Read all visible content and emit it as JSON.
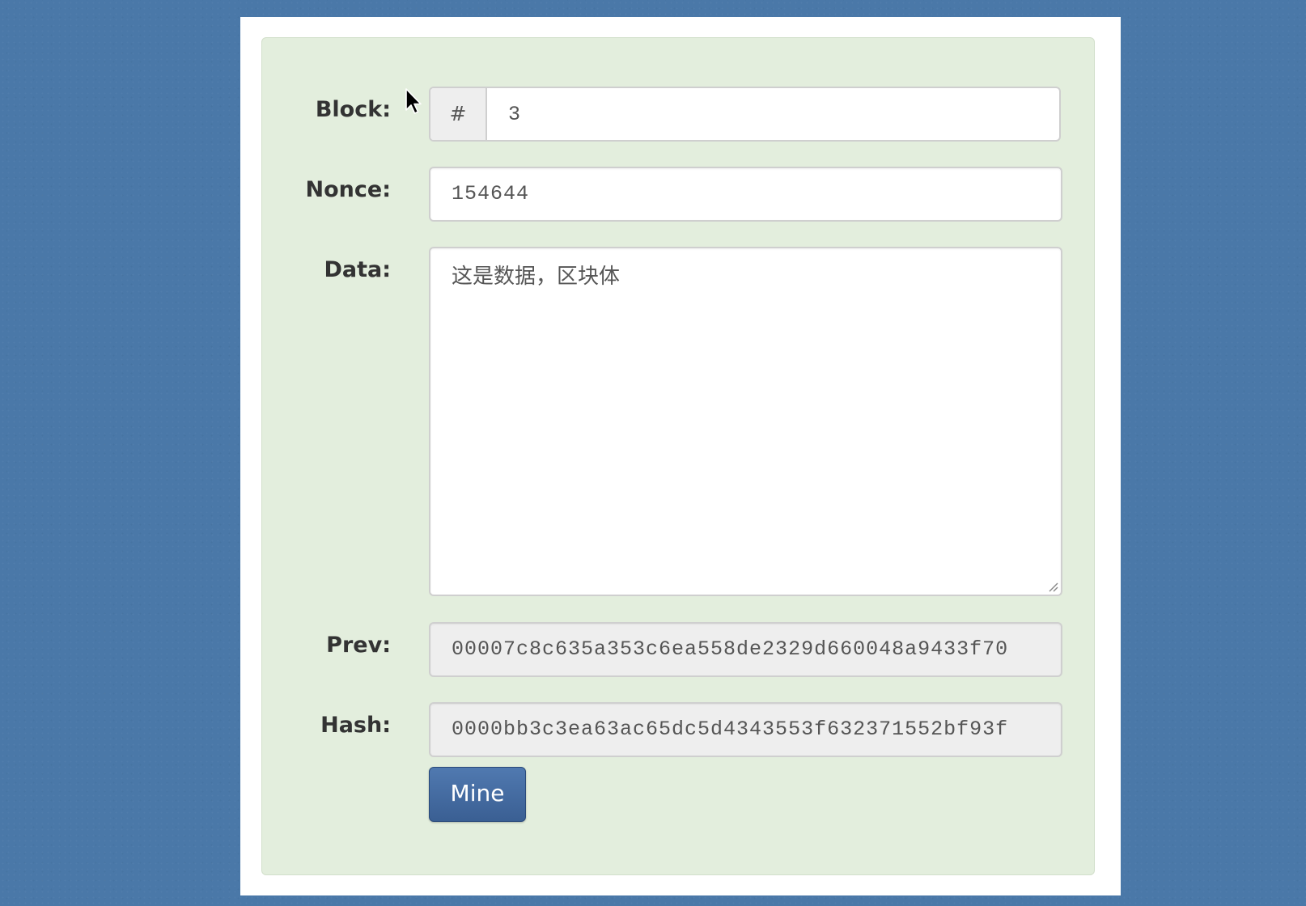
{
  "block_form": {
    "block": {
      "label": "Block:",
      "prefix": "#",
      "value": "3"
    },
    "nonce": {
      "label": "Nonce:",
      "value": "154644"
    },
    "data": {
      "label": "Data:",
      "value": "这是数据，区块体"
    },
    "prev": {
      "label": "Prev:",
      "value": "00007c8c635a353c6ea558de2329d660048a9433f70"
    },
    "hash": {
      "label": "Hash:",
      "value": "0000bb3c3ea63ac65dc5d4343553f632371552bf93f"
    },
    "mine_button_label": "Mine"
  },
  "colors": {
    "background": "#4a78a8",
    "panel": "#e3eedd",
    "button": "#3f6598"
  }
}
